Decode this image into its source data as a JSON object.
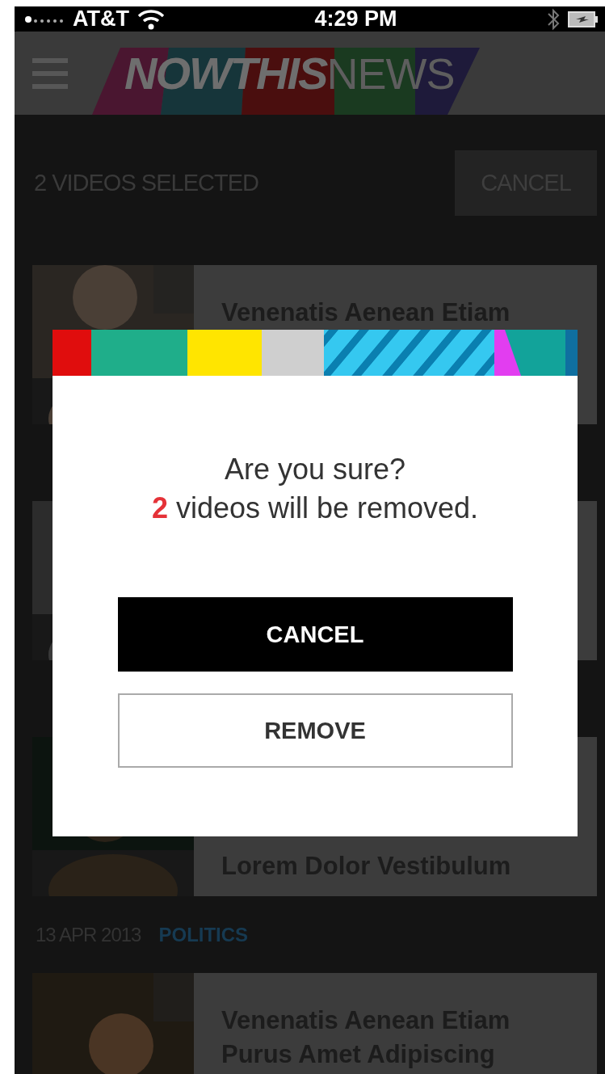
{
  "status_bar": {
    "carrier": "AT&T",
    "time": "4:29 PM"
  },
  "header": {
    "logo_bold": "NOWTHIS",
    "logo_light": "NEWS"
  },
  "selection_bar": {
    "label": "2 VIDEOS SELECTED",
    "button": "CANCEL"
  },
  "cards": [
    {
      "thumbnail": {
        "kind": "picture"
      },
      "title_cut_top": false,
      "lines": [
        "Venenatis Aenean Etiam"
      ]
    },
    {
      "thumbnail": {
        "kind": "picture"
      }
    },
    {
      "thumbnail": {
        "kind": "picture"
      },
      "title_cut_top": true,
      "lines": [
        "Lorem Dolor Vestibulum"
      ],
      "meta": {
        "date": "13 APR 2013",
        "category": "POLITICS"
      }
    },
    {
      "thumbnail": {
        "kind": "picture"
      },
      "title_cut_top": false,
      "lines": [
        "Venenatis Aenean Etiam",
        "Purus Amet Adipiscing"
      ]
    }
  ],
  "dialog": {
    "question": "Are you sure?",
    "count": "2",
    "message": " videos will be removed.",
    "buttons": [
      {
        "kind": "primary",
        "label": "CANCEL"
      },
      {
        "kind": "secondary",
        "label": "REMOVE"
      }
    ]
  }
}
